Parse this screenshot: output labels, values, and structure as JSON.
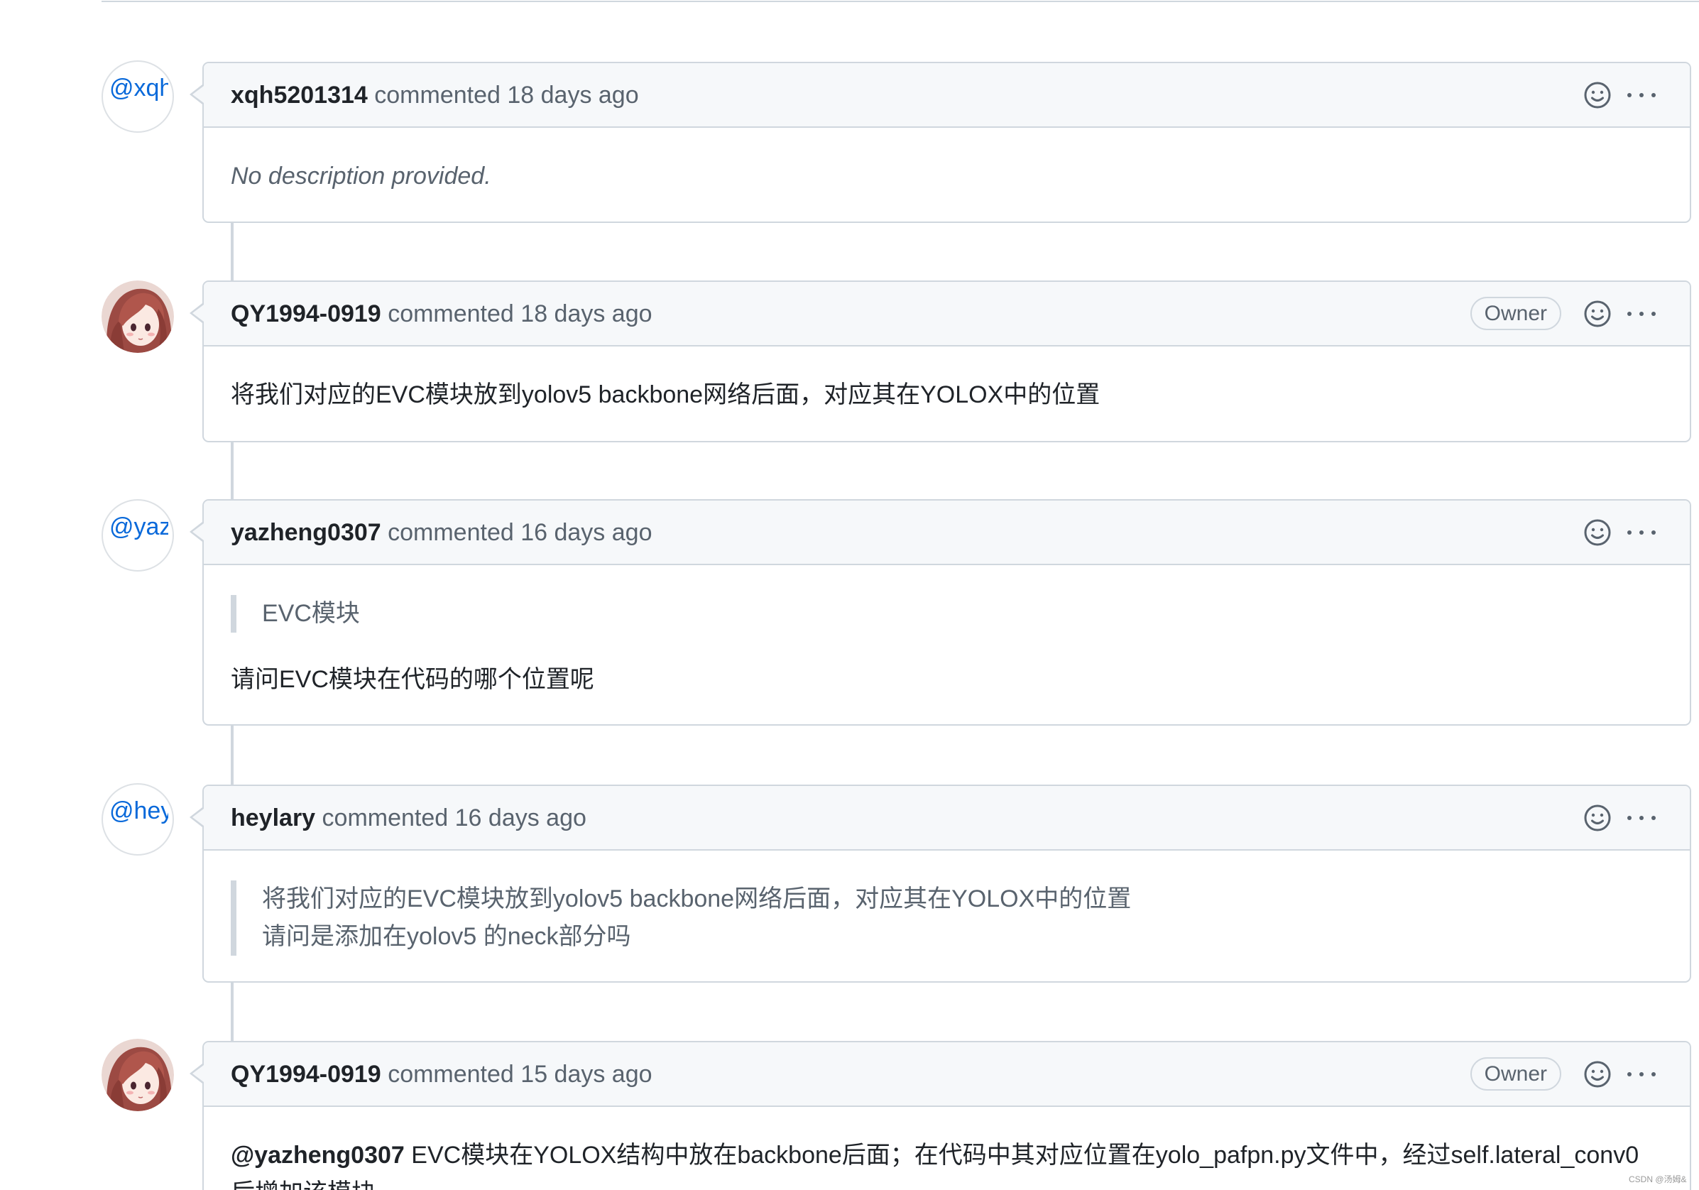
{
  "comments": [
    {
      "avatar_alt": "@xqh",
      "author": "xqh5201314",
      "action": "commented",
      "time": "18 days ago",
      "body": "No description provided."
    },
    {
      "avatar_icon": "anime-girl-avatar",
      "author": "QY1994-0919",
      "action": "commented",
      "time": "18 days ago",
      "badge": "Owner",
      "body": "将我们对应的EVC模块放到yolov5 backbone网络后面，对应其在YOLOX中的位置"
    },
    {
      "avatar_alt": "@yaz",
      "author": "yazheng0307",
      "action": "commented",
      "time": "16 days ago",
      "quote": [
        "EVC模块"
      ],
      "body": "请问EVC模块在代码的哪个位置呢"
    },
    {
      "avatar_alt": "@hey",
      "author": "heylary",
      "action": "commented",
      "time": "16 days ago",
      "quote": [
        "将我们对应的EVC模块放到yolov5 backbone网络后面，对应其在YOLOX中的位置",
        "请问是添加在yolov5 的neck部分吗"
      ]
    },
    {
      "avatar_icon": "anime-girl-avatar",
      "author": "QY1994-0919",
      "action": "commented",
      "time": "15 days ago",
      "badge": "Owner",
      "mention": "@yazheng0307",
      "body_lines": [
        "EVC模块在YOLOX结构中放在backbone后面；在代码中其对应位置在yolo_pafpn.py文件中，经过self.lateral_conv0",
        "后增加该模块"
      ]
    }
  ],
  "icons": {
    "reaction": "smiley-icon",
    "more": "kebab-horizontal-icon"
  },
  "colors": {
    "link": "#0969da",
    "text": "#1f2328",
    "muted": "#59636e",
    "border": "#d0d7de",
    "header_bg": "#f6f8fa"
  },
  "watermark": "CSDN @汤姆&"
}
